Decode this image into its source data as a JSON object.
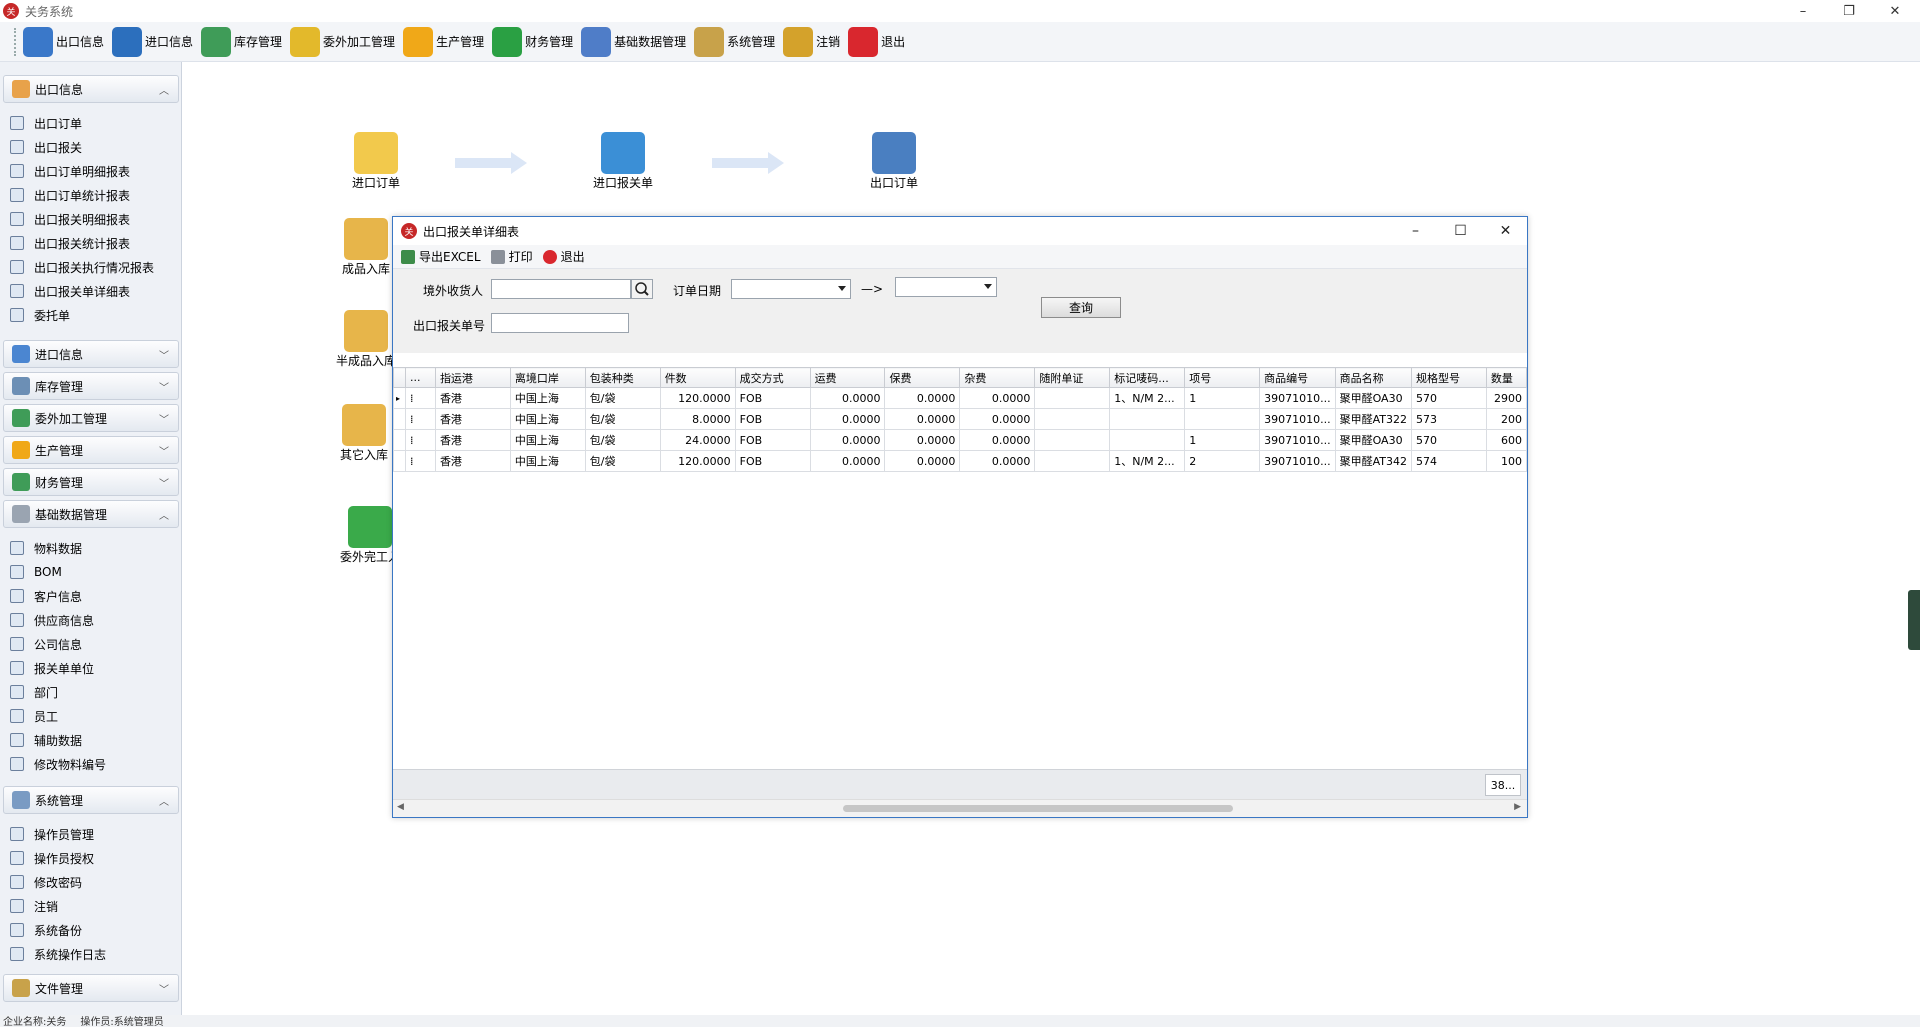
{
  "app": {
    "title": "关务系统",
    "icon_text": "关"
  },
  "menubar": [
    {
      "label": "出口信息",
      "icon": "pencil-icon",
      "color": "#3a78c9"
    },
    {
      "label": "进口信息",
      "icon": "basket-icon",
      "color": "#2c6fbd"
    },
    {
      "label": "库存管理",
      "icon": "warehouse-icon",
      "color": "#3f9c58"
    },
    {
      "label": "委外加工管理",
      "icon": "folder-icon",
      "color": "#e3b92b"
    },
    {
      "label": "生产管理",
      "icon": "gear-icon",
      "color": "#f0a818"
    },
    {
      "label": "财务管理",
      "icon": "dollar-icon",
      "color": "#2aa043"
    },
    {
      "label": "基础数据管理",
      "icon": "calendar-icon",
      "color": "#4f7dc8"
    },
    {
      "label": "系统管理",
      "icon": "tools-icon",
      "color": "#c8a24a"
    },
    {
      "label": "注销",
      "icon": "key-icon",
      "color": "#d4a22b"
    },
    {
      "label": "退出",
      "icon": "close-icon",
      "color": "#d9272e"
    }
  ],
  "sidebar": {
    "export_group": "出口信息",
    "export_items": [
      "出口订单",
      "出口报关",
      "出口订单明细报表",
      "出口订单统计报表",
      "出口报关明细报表",
      "出口报关统计报表",
      "出口报关执行情况报表",
      "出口报关单详细表",
      "委托单"
    ],
    "collapsed_groups": [
      "进口信息",
      "库存管理",
      "委外加工管理",
      "生产管理",
      "财务管理"
    ],
    "basic_group": "基础数据管理",
    "basic_items": [
      "物料数据",
      "BOM",
      "客户信息",
      "供应商信息",
      "公司信息",
      "报关单单位",
      "部门",
      "员工",
      "辅助数据",
      "修改物料编号"
    ],
    "system_group": "系统管理",
    "system_items": [
      "操作员管理",
      "操作员授权",
      "修改密码",
      "注销",
      "系统备份",
      "系统操作日志"
    ],
    "file_group": "文件管理"
  },
  "flow": {
    "top": [
      "进口订单",
      "进口报关单",
      "出口订单"
    ],
    "left": [
      "成品入库",
      "半成品入库",
      "其它入库",
      "委外完工入"
    ]
  },
  "status": {
    "company": "企业名称:关务",
    "operator": "操作员:系统管理员"
  },
  "dialog": {
    "title": "出口报关单详细表",
    "toolbar": {
      "export": "导出EXCEL",
      "print": "打印",
      "exit": "退出"
    },
    "filter": {
      "consignee_label": "境外收货人",
      "order_date_label": "订单日期",
      "arrow": "—>",
      "declaration_no_label": "出口报关单号",
      "query_button": "查询"
    },
    "columns": [
      "...",
      "指运港",
      "离境口岸",
      "包装种类",
      "件数",
      "成交方式",
      "运费",
      "保费",
      "杂费",
      "随附单证",
      "标记唛码...",
      "项号",
      "商品编号",
      "商品名称",
      "规格型号",
      "数量"
    ],
    "rows": [
      [
        "香港",
        "中国上海",
        "包/袋",
        "120.0000",
        "FOB",
        "0.0000",
        "0.0000",
        "0.0000",
        "",
        "1、N/M 2...",
        "1",
        "39071010...",
        "聚甲醛OA30",
        "570",
        "2900"
      ],
      [
        "香港",
        "中国上海",
        "包/袋",
        "8.0000",
        "FOB",
        "0.0000",
        "0.0000",
        "0.0000",
        "",
        "",
        "",
        "39071010...",
        "聚甲醛AT322",
        "573",
        "200"
      ],
      [
        "香港",
        "中国上海",
        "包/袋",
        "24.0000",
        "FOB",
        "0.0000",
        "0.0000",
        "0.0000",
        "",
        "",
        "1",
        "39071010...",
        "聚甲醛OA30",
        "570",
        "600"
      ],
      [
        "香港",
        "中国上海",
        "包/袋",
        "120.0000",
        "FOB",
        "0.0000",
        "0.0000",
        "0.0000",
        "",
        "1、N/M 2...",
        "2",
        "39071010...",
        "聚甲醛AT342",
        "574",
        "100"
      ]
    ],
    "record_count": "38..."
  }
}
